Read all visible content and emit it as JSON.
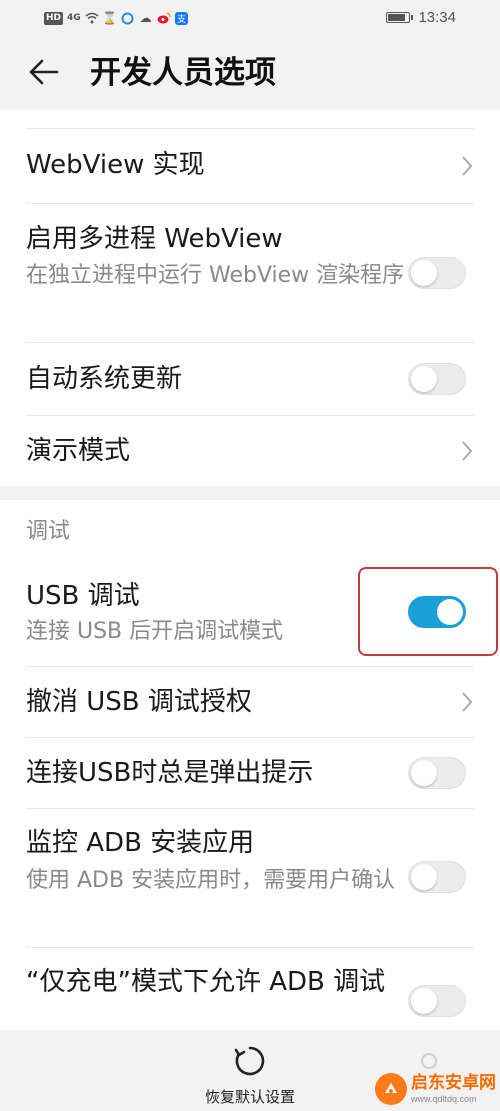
{
  "status_bar": {
    "badge": "HD",
    "signal_label": "4G",
    "icons": [
      "wifi-icon",
      "hourglass-icon",
      "circle-app-icon",
      "cloud-icon",
      "weibo-icon",
      "alipay-icon"
    ],
    "battery_level": 0.85,
    "time": "13:34"
  },
  "header": {
    "title": "开发人员选项"
  },
  "settings": {
    "webview_impl": {
      "title": "WebView 实现"
    },
    "multiprocess_webview": {
      "title": "启用多进程 WebView",
      "subtitle": "在独立进程中运行 WebView 渲染程序",
      "enabled": false
    },
    "auto_update": {
      "title": "自动系统更新",
      "enabled": false
    },
    "demo_mode": {
      "title": "演示模式"
    },
    "debug_section": "调试",
    "usb_debug": {
      "title": "USB 调试",
      "subtitle": "连接 USB 后开启调试模式",
      "enabled": true
    },
    "revoke_usb": {
      "title": "撤消 USB 调试授权"
    },
    "usb_prompt": {
      "title": "连接USB时总是弹出提示",
      "enabled": false
    },
    "adb_monitor": {
      "title": "监控 ADB 安装应用",
      "subtitle": "使用 ADB 安装应用时，需要用户确认",
      "enabled": false
    },
    "adb_charge": {
      "title": "“仅充电”模式下允许 ADB 调试",
      "enabled": false
    }
  },
  "bottom": {
    "reset_label": "恢复默认设置"
  },
  "watermark": {
    "name": "启东安卓网",
    "url": "www.qdltdq.com"
  },
  "colors": {
    "accent": "#1aa0d6",
    "highlight": "#c9393f",
    "background": "#f2f2f2"
  }
}
